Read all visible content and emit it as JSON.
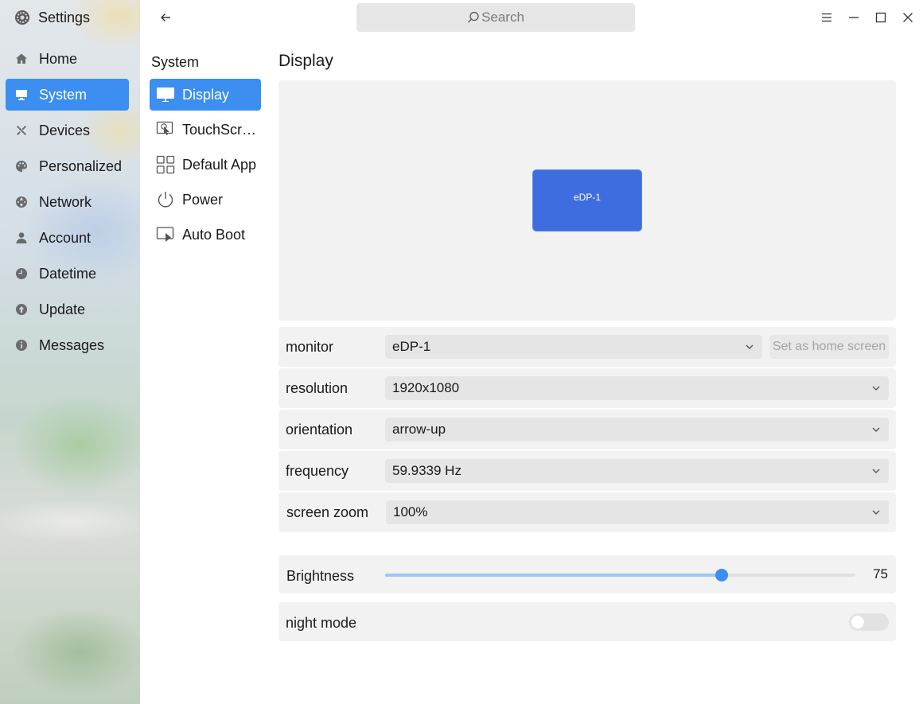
{
  "app": {
    "title": "Settings"
  },
  "sidebar": {
    "items": [
      {
        "label": "Home",
        "icon": "home-icon"
      },
      {
        "label": "System",
        "icon": "monitor-icon",
        "active": true
      },
      {
        "label": "Devices",
        "icon": "tools-icon"
      },
      {
        "label": "Personalized",
        "icon": "palette-icon"
      },
      {
        "label": "Network",
        "icon": "globe-icon"
      },
      {
        "label": "Account",
        "icon": "user-icon"
      },
      {
        "label": "Datetime",
        "icon": "clock-icon"
      },
      {
        "label": "Update",
        "icon": "update-icon"
      },
      {
        "label": "Messages",
        "icon": "info-icon"
      }
    ]
  },
  "search": {
    "placeholder": "Search"
  },
  "subnav": {
    "heading": "System",
    "items": [
      {
        "label": "Display",
        "active": true
      },
      {
        "label": "TouchScreen"
      },
      {
        "label": "Default App"
      },
      {
        "label": "Power"
      },
      {
        "label": "Auto Boot"
      }
    ]
  },
  "display": {
    "title": "Display",
    "monitor_block_label": "eDP-1",
    "monitor": {
      "label": "monitor",
      "value": "eDP-1",
      "home_button": "Set as home screen"
    },
    "resolution": {
      "label": "resolution",
      "value": "1920x1080"
    },
    "orientation": {
      "label": "orientation",
      "value": "arrow-up"
    },
    "frequency": {
      "label": "frequency",
      "value": "59.9339 Hz"
    },
    "screen_zoom": {
      "label": "screen zoom",
      "value": "100%"
    },
    "brightness": {
      "label": "Brightness",
      "value": 75,
      "value_text": "75",
      "fraction": 0.716
    },
    "night_mode": {
      "label": "night mode",
      "enabled": false
    }
  },
  "colors": {
    "accent": "#3c8ef0",
    "monitor_block": "#3e6de0"
  }
}
